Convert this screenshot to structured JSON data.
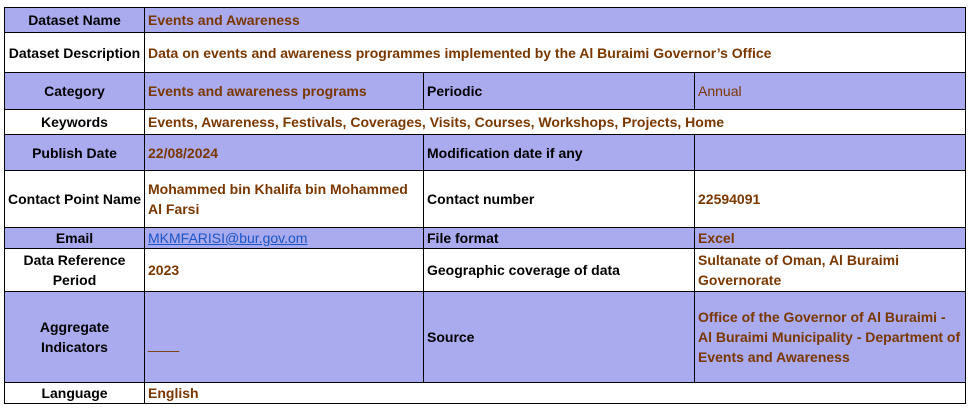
{
  "rows": {
    "dataset_name": {
      "label": "Dataset Name",
      "value": "Events and Awareness"
    },
    "dataset_description": {
      "label": "Dataset Description",
      "value": "Data on events and awareness programmes implemented by the Al Buraimi Governor’s Office"
    },
    "category": {
      "label": "Category",
      "value": "Events and awareness programs",
      "label2": "Periodic",
      "value2": "Annual"
    },
    "keywords": {
      "label": "Keywords",
      "value": "Events, Awareness, Festivals, Coverages, Visits, Courses, Workshops, Projects, Home"
    },
    "publish_date": {
      "label": "Publish Date",
      "value": "22/08/2024",
      "label2": "Modification date if any",
      "value2": ""
    },
    "contact_point": {
      "label": "Contact Point Name",
      "value": "Mohammed bin Khalifa bin Mohammed Al Farsi",
      "label2": "Contact number",
      "value2": "22594091"
    },
    "email": {
      "label": "Email",
      "value": "MKMFARISI@bur.gov.om",
      "label2": "File format",
      "value2": "Excel"
    },
    "data_reference_period": {
      "label": "Data Reference Period",
      "value": "2023",
      "label2": "Geographic coverage of data",
      "value2": "Sultanate of Oman, Al Buraimi Governorate"
    },
    "aggregate_indicators": {
      "label": "Aggregate Indicators",
      "value": "____",
      "label2": "Source",
      "value2": "Office of the Governor of Al Buraimi - Al Buraimi Municipality - Department of Events and Awareness"
    },
    "language": {
      "label": "Language",
      "value": "English"
    }
  }
}
